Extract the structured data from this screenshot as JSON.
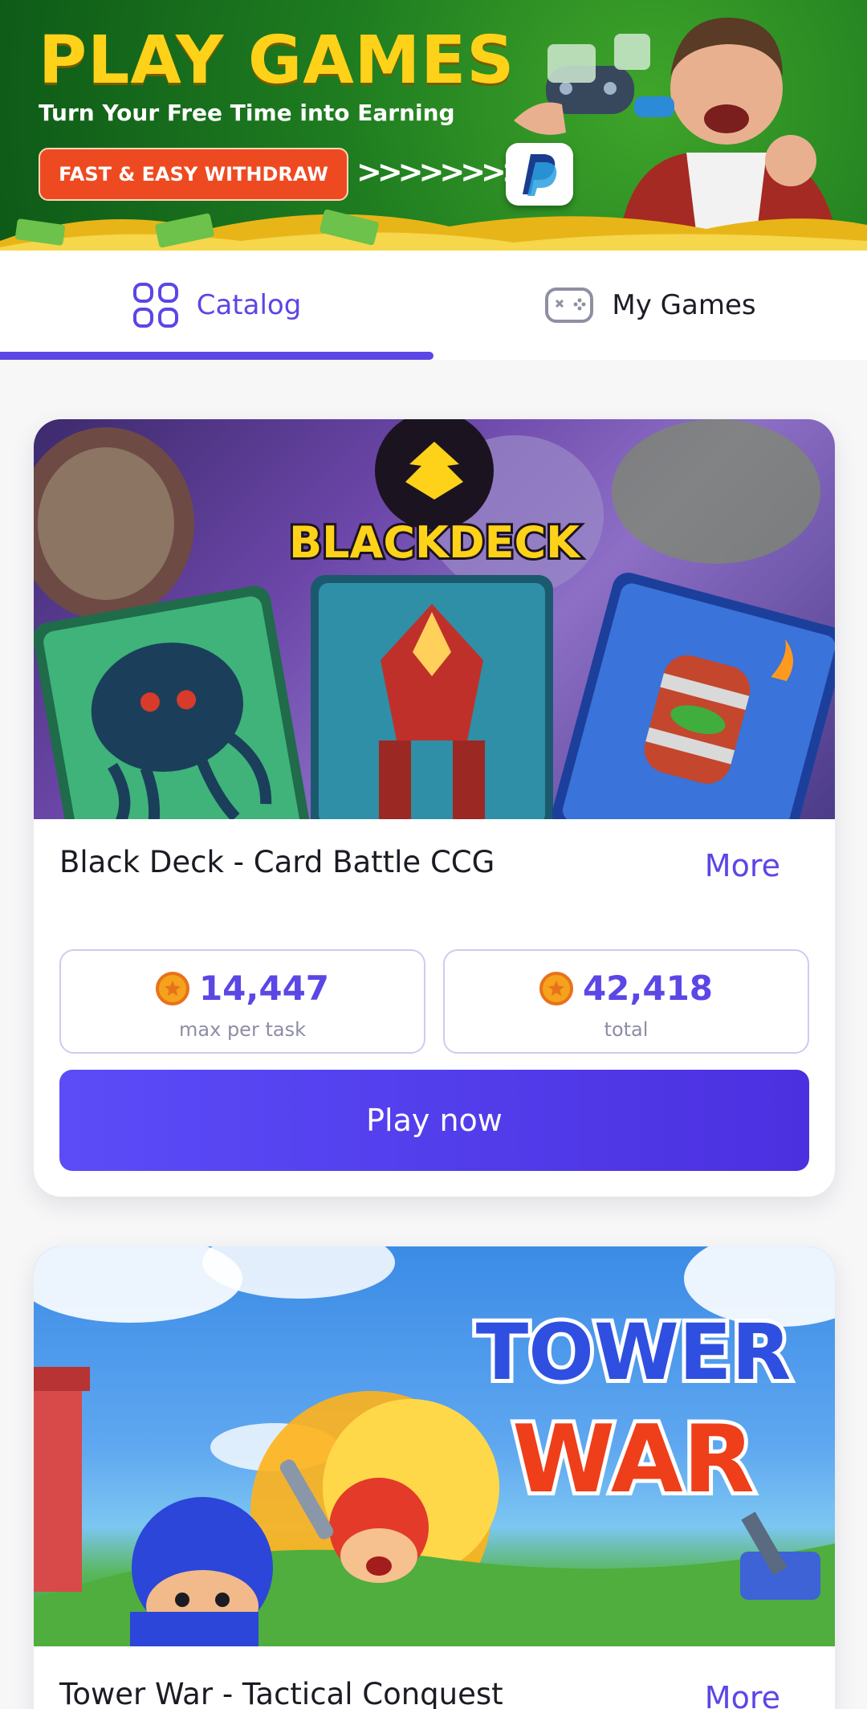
{
  "banner": {
    "title": "PLAY GAMES",
    "subtitle": "Turn Your Free Time into Earning",
    "button_label": "FAST & EASY WITHDRAW",
    "arrows": ">>>>>>>>>",
    "payment_icon": "paypal-icon"
  },
  "tabs": [
    {
      "label": "Catalog",
      "icon": "grid-icon",
      "selected": true
    },
    {
      "label": "My Games",
      "icon": "gamepad-icon",
      "selected": false
    }
  ],
  "games": [
    {
      "art_text": "BLACKDECK",
      "title": "Black Deck - Card Battle CCG",
      "more_label": "More",
      "max_per_task": "14,447",
      "max_per_task_label": "max per task",
      "total": "42,418",
      "total_label": "total",
      "play_label": "Play now"
    },
    {
      "art_text_line1": "TOWER",
      "art_text_line2": "WAR",
      "title": "Tower War - Tactical Conquest",
      "more_label": "More"
    }
  ],
  "colors": {
    "accent": "#5b46e6",
    "banner_green": "#1f7d20",
    "banner_yellow": "#ffd21a",
    "withdraw_button": "#ee4a22",
    "coin": "#f5a21c"
  }
}
